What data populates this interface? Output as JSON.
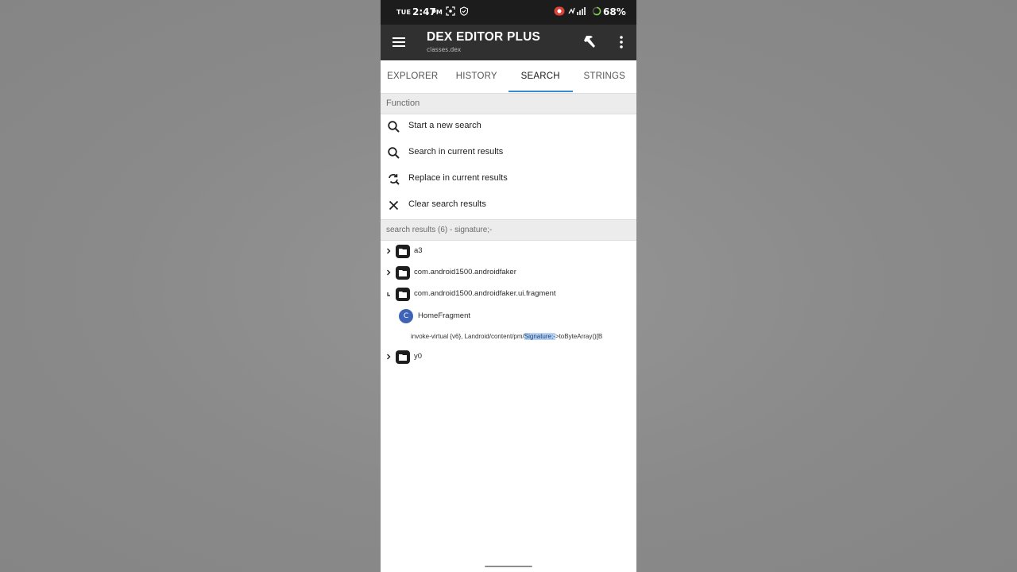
{
  "status_bar": {
    "day": "TUE",
    "time": "2:47",
    "ampm": "PM",
    "battery": "68%"
  },
  "toolbar": {
    "title": "DEX EDITOR PLUS",
    "subtitle": "classes.dex"
  },
  "tabs": [
    {
      "label": "EXPLORER",
      "active": false
    },
    {
      "label": "HISTORY",
      "active": false
    },
    {
      "label": "SEARCH",
      "active": true
    },
    {
      "label": "STRINGS",
      "active": false
    }
  ],
  "function_section": {
    "header": "Function",
    "items": [
      {
        "label": "Start a new search",
        "icon": "search-icon"
      },
      {
        "label": "Search in current results",
        "icon": "search-icon"
      },
      {
        "label": "Replace in current results",
        "icon": "replace-icon"
      },
      {
        "label": "Clear search results",
        "icon": "close-icon"
      }
    ]
  },
  "results_section": {
    "header": "search results (6) - signature;-",
    "tree": [
      {
        "label": "a3",
        "expanded": false
      },
      {
        "label": "com.android1500.androidfaker",
        "expanded": false
      },
      {
        "label": "com.android1500.androidfaker.ui.fragment",
        "expanded": true
      },
      {
        "label": "y0",
        "expanded": false
      }
    ],
    "class_node": {
      "badge": "C",
      "label": "HomeFragment"
    },
    "code_match": {
      "before": "invoke-virtual {v6}, Landroid/content/pm/",
      "highlight": "Signature;-",
      "after": ">toByteArray()[B"
    }
  },
  "colors": {
    "toolbar": "#303030",
    "status_bar": "#1c1c1c",
    "tab_indicator": "#3a8ad6",
    "class_badge": "#3f63b5",
    "highlight": "#b9d3f3"
  }
}
